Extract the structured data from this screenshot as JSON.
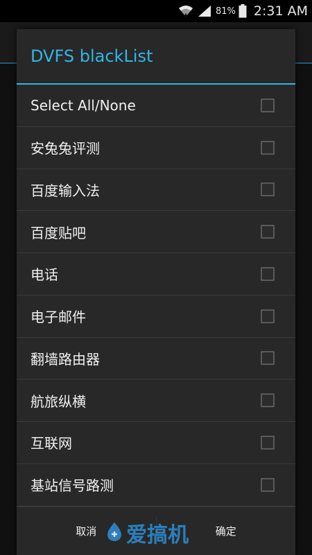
{
  "status_bar": {
    "battery_percent": "81%",
    "time": "2:31 AM"
  },
  "dialog": {
    "title": "DVFS blackList",
    "items": [
      {
        "label": "Select All/None",
        "checked": false
      },
      {
        "label": "安兔兔评测",
        "checked": false
      },
      {
        "label": "百度输入法",
        "checked": false
      },
      {
        "label": "百度贴吧",
        "checked": false
      },
      {
        "label": "电话",
        "checked": false
      },
      {
        "label": "电子邮件",
        "checked": false
      },
      {
        "label": "翻墙路由器",
        "checked": false
      },
      {
        "label": "航旅纵横",
        "checked": false
      },
      {
        "label": "互联网",
        "checked": false
      },
      {
        "label": "基站信号路测",
        "checked": false
      }
    ],
    "cancel_label": "取消",
    "ok_label": "确定"
  },
  "watermark": {
    "text": "爱搞机"
  },
  "colors": {
    "accent": "#33b5e5",
    "dialog_bg": "#282828",
    "watermark": "#2d8fd6"
  }
}
